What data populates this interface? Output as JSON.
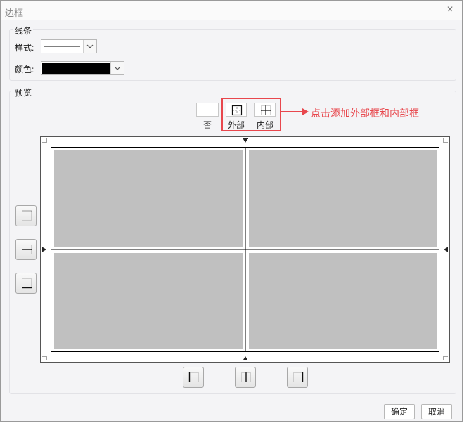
{
  "window": {
    "title": "边框",
    "close_glyph": "×"
  },
  "line_group": {
    "label": "线条",
    "style_label": "样式:",
    "color_label": "颜色:",
    "color_value": "#000000"
  },
  "preview_group": {
    "label": "预览",
    "presets": [
      {
        "label": "否",
        "icon": "border-none-icon"
      },
      {
        "label": "外部",
        "icon": "border-outside-icon"
      },
      {
        "label": "内部",
        "icon": "border-inside-icon"
      }
    ],
    "annotation": "点击添加外部框和内部框"
  },
  "buttons": {
    "ok": "确定",
    "cancel": "取消"
  },
  "colors": {
    "accent": "#e8474d",
    "cell_fill": "#c0c0c0"
  }
}
